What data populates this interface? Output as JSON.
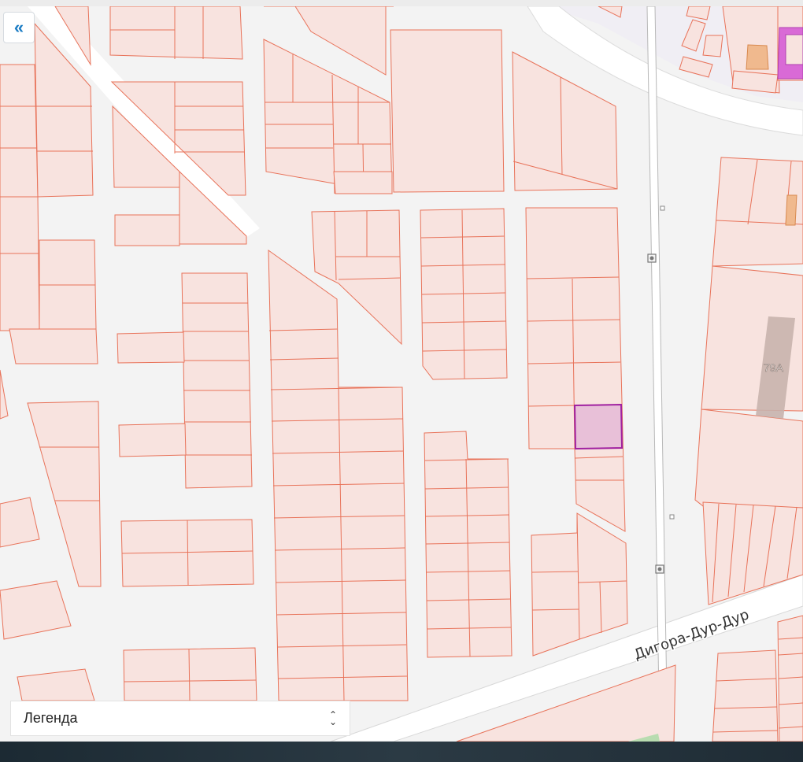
{
  "map": {
    "street_label": "Дигора-Дур-Дур",
    "building_label": "79А",
    "colors": {
      "parcel_fill": "#f8e3df",
      "parcel_stroke": "#e8735a",
      "selected_fill": "#e8c0d8",
      "selected_stroke": "#a020a0",
      "road": "#ffffff",
      "building": "#c8b3ad",
      "orange_building": "#f0b98e",
      "magenta_building": "#d96ad6"
    }
  },
  "controls": {
    "collapse_icon": "double-chevron-left-icon",
    "legend_label": "Легенда",
    "legend_toggle_icon": "chevron-up-down-icon"
  }
}
